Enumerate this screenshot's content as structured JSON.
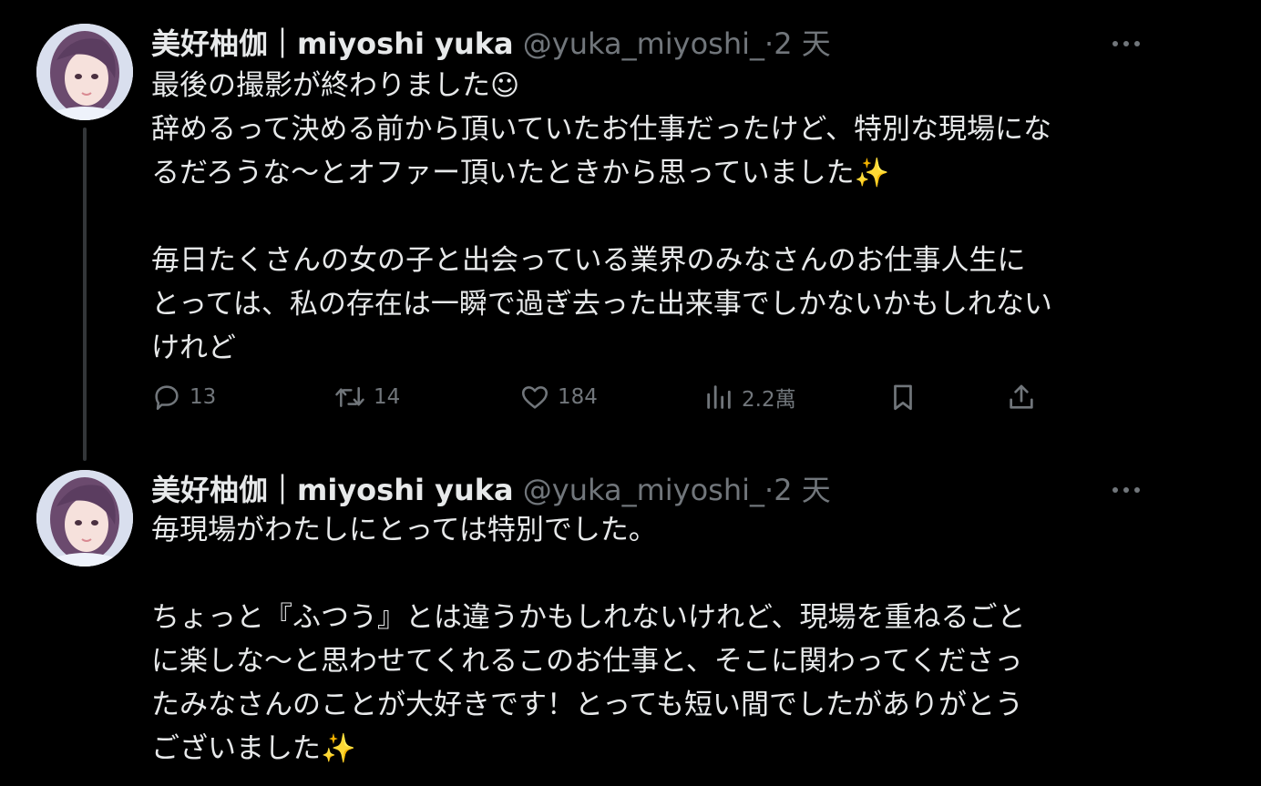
{
  "tweets": [
    {
      "author_name": "美好柚伽｜miyoshi yuka",
      "handle": "@yuka_miyoshi_",
      "separator": "·",
      "time": "2 天",
      "lines": [
        "最後の撮影が終わりました☺︎",
        "辞めるって決める前から頂いていたお仕事だったけど、特別な現場にな",
        "るだろうな〜とオファー頂いたときから思っていました✨",
        "",
        "毎日たくさんの女の子と出会っている業界のみなさんのお仕事人生に",
        "とっては、私の存在は一瞬で過ぎ去った出来事でしかないかもしれない",
        "けれど"
      ],
      "actions": {
        "replies": "13",
        "retweets": "14",
        "likes": "184",
        "views": "2.2萬"
      }
    },
    {
      "author_name": "美好柚伽｜miyoshi yuka",
      "handle": "@yuka_miyoshi_",
      "separator": "·",
      "time": "2 天",
      "lines": [
        "毎現場がわたしにとっては特別でした。",
        "",
        "ちょっと『ふつう』とは違うかもしれないけれど、現場を重ねるごと",
        "に楽しな〜と思わせてくれるこのお仕事と、そこに関わってくださっ",
        "たみなさんのことが大好きです！とっても短い間でしたがありがとう",
        "ございました✨"
      ]
    }
  ],
  "icons": {
    "more": "more-horizontal-icon",
    "reply": "reply-bubble-icon",
    "retweet": "retweet-icon",
    "like": "heart-icon",
    "views": "views-bar-chart-icon",
    "bookmark": "bookmark-icon",
    "share": "share-upload-icon"
  },
  "colors": {
    "background": "#000000",
    "text_primary": "#e7e9ea",
    "text_secondary": "#71767b",
    "thread_line": "#333639"
  }
}
